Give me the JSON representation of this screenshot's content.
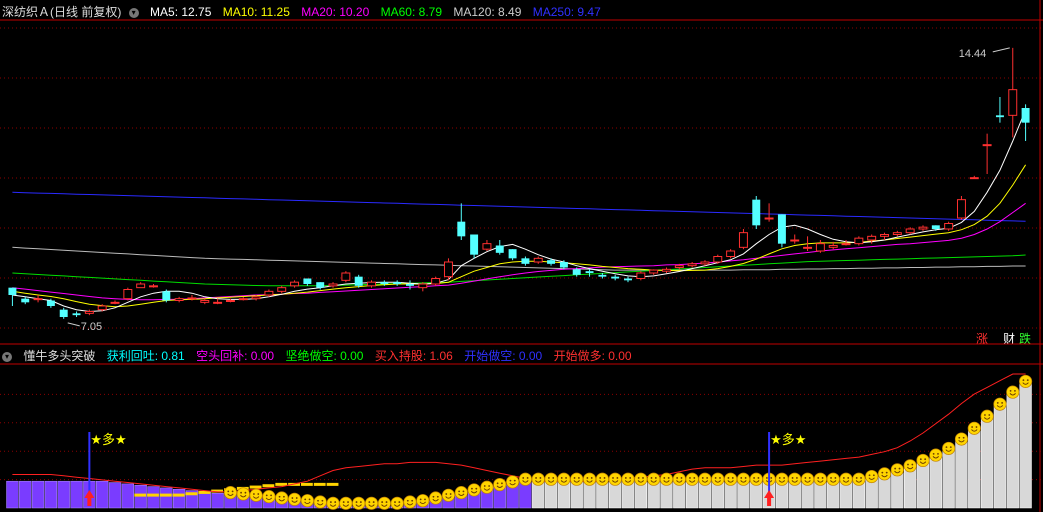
{
  "main_panel": {
    "stock_title": "深纺织Ａ(日线 前复权)",
    "ma": [
      {
        "label": "MA5: 12.75",
        "color": "#ffffff"
      },
      {
        "label": "MA10: 11.25",
        "color": "#ffff00"
      },
      {
        "label": "MA20: 10.20",
        "color": "#ff00ff"
      },
      {
        "label": "MA60: 8.79",
        "color": "#00ff00"
      },
      {
        "label": "MA120: 8.49",
        "color": "#cccccc"
      },
      {
        "label": "MA250: 9.47",
        "color": "#3030ff"
      }
    ],
    "high_label": "14.44",
    "low_label": "7.05",
    "side_buttons": [
      {
        "label": "涨",
        "color": "#ff3030"
      },
      {
        "label": "财",
        "color": "#ffffff"
      },
      {
        "label": "跌",
        "color": "#30ff30"
      }
    ]
  },
  "indicator_panel": {
    "name": "懂牛多头突破",
    "values": [
      {
        "label": "获利回吐: 0.81",
        "color": "#00ffff"
      },
      {
        "label": "空头回补: 0.00",
        "color": "#ff00ff"
      },
      {
        "label": "坚绝做空: 0.00",
        "color": "#00ff00"
      },
      {
        "label": "买入持股: 1.06",
        "color": "#ff3030"
      },
      {
        "label": "开始做空: 0.00",
        "color": "#3030ff"
      },
      {
        "label": "开始做多: 0.00",
        "color": "#ff3030"
      }
    ],
    "signal_text": "★多★"
  },
  "colors": {
    "up": "#ff3030",
    "down": "#54ffff",
    "grid": "#8b0000",
    "separator": "#c00000"
  },
  "chart_data": {
    "type": "candlestick",
    "candles": [
      [
        7.9,
        7.9,
        7.4,
        7.7
      ],
      [
        7.6,
        7.65,
        7.45,
        7.5
      ],
      [
        7.6,
        7.7,
        7.5,
        7.6
      ],
      [
        7.55,
        7.6,
        7.35,
        7.4
      ],
      [
        7.3,
        7.35,
        7.05,
        7.1
      ],
      [
        7.2,
        7.25,
        7.1,
        7.15
      ],
      [
        7.2,
        7.3,
        7.15,
        7.25
      ],
      [
        7.3,
        7.45,
        7.25,
        7.4
      ],
      [
        7.5,
        7.55,
        7.45,
        7.5
      ],
      [
        7.6,
        7.9,
        7.55,
        7.85
      ],
      [
        7.9,
        8.05,
        7.9,
        8.0
      ],
      [
        7.95,
        8.0,
        7.9,
        7.95
      ],
      [
        7.8,
        7.85,
        7.5,
        7.55
      ],
      [
        7.55,
        7.65,
        7.5,
        7.6
      ],
      [
        7.6,
        7.7,
        7.55,
        7.62
      ],
      [
        7.5,
        7.6,
        7.45,
        7.55
      ],
      [
        7.5,
        7.6,
        7.45,
        7.5
      ],
      [
        7.55,
        7.6,
        7.5,
        7.55
      ],
      [
        7.6,
        7.65,
        7.55,
        7.6
      ],
      [
        7.6,
        7.7,
        7.55,
        7.65
      ],
      [
        7.7,
        7.85,
        7.65,
        7.8
      ],
      [
        7.8,
        7.95,
        7.75,
        7.9
      ],
      [
        7.95,
        8.1,
        7.9,
        8.05
      ],
      [
        8.15,
        8.15,
        7.95,
        8.0
      ],
      [
        8.05,
        8.05,
        7.85,
        7.9
      ],
      [
        7.95,
        8.05,
        7.9,
        8.0
      ],
      [
        8.1,
        8.35,
        8.05,
        8.3
      ],
      [
        8.2,
        8.25,
        7.9,
        7.95
      ],
      [
        7.95,
        8.1,
        7.9,
        8.05
      ],
      [
        8.05,
        8.1,
        7.95,
        8.0
      ],
      [
        8.05,
        8.1,
        7.95,
        8.0
      ],
      [
        8.0,
        8.1,
        7.85,
        7.95
      ],
      [
        7.9,
        8.05,
        7.8,
        8.0
      ],
      [
        8.0,
        8.2,
        7.95,
        8.15
      ],
      [
        8.2,
        8.7,
        8.1,
        8.6
      ],
      [
        9.7,
        10.2,
        9.2,
        9.3
      ],
      [
        9.35,
        9.35,
        8.7,
        8.8
      ],
      [
        8.95,
        9.2,
        8.9,
        9.1
      ],
      [
        9.05,
        9.2,
        8.8,
        8.85
      ],
      [
        8.95,
        8.95,
        8.65,
        8.7
      ],
      [
        8.7,
        8.75,
        8.5,
        8.55
      ],
      [
        8.6,
        8.75,
        8.55,
        8.7
      ],
      [
        8.65,
        8.7,
        8.5,
        8.55
      ],
      [
        8.6,
        8.65,
        8.4,
        8.45
      ],
      [
        8.4,
        8.45,
        8.2,
        8.25
      ],
      [
        8.35,
        8.4,
        8.2,
        8.3
      ],
      [
        8.25,
        8.3,
        8.15,
        8.2
      ],
      [
        8.2,
        8.25,
        8.1,
        8.15
      ],
      [
        8.15,
        8.2,
        8.05,
        8.1
      ],
      [
        8.15,
        8.35,
        8.1,
        8.3
      ],
      [
        8.3,
        8.4,
        8.25,
        8.38
      ],
      [
        8.35,
        8.45,
        8.3,
        8.4
      ],
      [
        8.45,
        8.55,
        8.4,
        8.5
      ],
      [
        8.5,
        8.6,
        8.45,
        8.55
      ],
      [
        8.55,
        8.65,
        8.5,
        8.6
      ],
      [
        8.6,
        8.8,
        8.55,
        8.75
      ],
      [
        8.75,
        8.95,
        8.7,
        8.9
      ],
      [
        9.0,
        9.5,
        8.95,
        9.4
      ],
      [
        10.3,
        10.4,
        9.5,
        9.6
      ],
      [
        9.8,
        10.2,
        9.7,
        9.8
      ],
      [
        9.9,
        9.9,
        9.0,
        9.1
      ],
      [
        9.2,
        9.35,
        9.1,
        9.2
      ],
      [
        9.0,
        9.3,
        8.9,
        9.0
      ],
      [
        8.9,
        9.2,
        8.85,
        9.1
      ],
      [
        9.0,
        9.15,
        8.95,
        9.05
      ],
      [
        9.1,
        9.2,
        9.05,
        9.1
      ],
      [
        9.1,
        9.3,
        9.05,
        9.25
      ],
      [
        9.2,
        9.35,
        9.1,
        9.3
      ],
      [
        9.3,
        9.4,
        9.2,
        9.35
      ],
      [
        9.35,
        9.45,
        9.3,
        9.4
      ],
      [
        9.4,
        9.55,
        9.35,
        9.5
      ],
      [
        9.5,
        9.6,
        9.45,
        9.55
      ],
      [
        9.6,
        9.6,
        9.45,
        9.5
      ],
      [
        9.5,
        9.7,
        9.45,
        9.65
      ],
      [
        9.8,
        10.4,
        9.75,
        10.3
      ],
      [
        10.9,
        10.95,
        10.9,
        10.9
      ],
      [
        11.8,
        12.1,
        11.0,
        11.8
      ],
      [
        12.6,
        13.1,
        12.4,
        12.55
      ],
      [
        12.6,
        14.44,
        12.0,
        13.3
      ],
      [
        12.8,
        12.9,
        11.9,
        12.4
      ]
    ],
    "ma5": [
      7.7,
      7.65,
      7.6,
      7.55,
      7.4,
      7.3,
      7.25,
      7.27,
      7.35,
      7.5,
      7.65,
      7.75,
      7.8,
      7.8,
      7.75,
      7.65,
      7.6,
      7.58,
      7.58,
      7.6,
      7.65,
      7.72,
      7.8,
      7.86,
      7.9,
      7.95,
      8.0,
      8.02,
      8.04,
      8.05,
      8.05,
      8.02,
      8.0,
      8.02,
      8.12,
      8.5,
      8.7,
      8.88,
      9.02,
      9.08,
      8.95,
      8.8,
      8.68,
      8.6,
      8.5,
      8.42,
      8.35,
      8.28,
      8.22,
      8.2,
      8.22,
      8.28,
      8.34,
      8.42,
      8.5,
      8.58,
      8.66,
      8.82,
      9.1,
      9.35,
      9.55,
      9.6,
      9.5,
      9.35,
      9.22,
      9.15,
      9.12,
      9.15,
      9.2,
      9.28,
      9.35,
      9.42,
      9.48,
      9.52,
      9.68,
      9.98,
      10.5,
      11.1,
      11.9,
      12.75
    ],
    "ma10": [
      7.8,
      7.75,
      7.7,
      7.66,
      7.6,
      7.52,
      7.45,
      7.41,
      7.38,
      7.4,
      7.45,
      7.5,
      7.55,
      7.57,
      7.58,
      7.6,
      7.62,
      7.64,
      7.66,
      7.68,
      7.7,
      7.72,
      7.75,
      7.78,
      7.82,
      7.86,
      7.9,
      7.93,
      7.96,
      7.98,
      8.0,
      8.0,
      8.0,
      8.01,
      8.05,
      8.2,
      8.35,
      8.45,
      8.55,
      8.6,
      8.62,
      8.62,
      8.6,
      8.58,
      8.55,
      8.52,
      8.48,
      8.45,
      8.42,
      8.4,
      8.38,
      8.37,
      8.36,
      8.37,
      8.38,
      8.42,
      8.48,
      8.56,
      8.68,
      8.82,
      8.96,
      9.05,
      9.1,
      9.12,
      9.12,
      9.12,
      9.14,
      9.17,
      9.2,
      9.24,
      9.28,
      9.32,
      9.36,
      9.4,
      9.48,
      9.62,
      9.85,
      10.2,
      10.7,
      11.25
    ],
    "ma20": [
      7.9,
      7.86,
      7.82,
      7.78,
      7.74,
      7.7,
      7.66,
      7.62,
      7.6,
      7.58,
      7.57,
      7.57,
      7.58,
      7.58,
      7.6,
      7.62,
      7.64,
      7.66,
      7.68,
      7.7,
      7.71,
      7.72,
      7.74,
      7.75,
      7.77,
      7.79,
      7.81,
      7.83,
      7.85,
      7.87,
      7.89,
      7.91,
      7.93,
      7.95,
      7.97,
      8.02,
      8.08,
      8.14,
      8.2,
      8.25,
      8.3,
      8.34,
      8.37,
      8.4,
      8.42,
      8.44,
      8.46,
      8.47,
      8.48,
      8.49,
      8.5,
      8.52,
      8.53,
      8.55,
      8.57,
      8.6,
      8.63,
      8.66,
      8.7,
      8.74,
      8.78,
      8.82,
      8.86,
      8.9,
      8.93,
      8.96,
      8.99,
      9.02,
      9.05,
      9.08,
      9.1,
      9.13,
      9.16,
      9.19,
      9.25,
      9.35,
      9.5,
      9.7,
      9.95,
      10.2
    ],
    "ma60": [
      8.3,
      8.28,
      8.26,
      8.24,
      8.22,
      8.2,
      8.18,
      8.16,
      8.14,
      8.12,
      8.1,
      8.08,
      8.06,
      8.04,
      8.02,
      8.0,
      7.99,
      7.98,
      7.97,
      7.96,
      7.95,
      7.95,
      7.95,
      7.95,
      7.95,
      7.96,
      7.97,
      7.98,
      7.99,
      8.0,
      8.01,
      8.02,
      8.03,
      8.04,
      8.05,
      8.07,
      8.09,
      8.11,
      8.13,
      8.15,
      8.17,
      8.19,
      8.21,
      8.23,
      8.25,
      8.27,
      8.29,
      8.31,
      8.33,
      8.35,
      8.37,
      8.39,
      8.41,
      8.43,
      8.45,
      8.47,
      8.49,
      8.51,
      8.53,
      8.55,
      8.57,
      8.59,
      8.61,
      8.62,
      8.63,
      8.64,
      8.65,
      8.66,
      8.67,
      8.68,
      8.69,
      8.7,
      8.71,
      8.72,
      8.73,
      8.74,
      8.75,
      8.76,
      8.77,
      8.79
    ],
    "ma120": [
      9.0,
      8.98,
      8.96,
      8.94,
      8.92,
      8.9,
      8.88,
      8.86,
      8.84,
      8.82,
      8.8,
      8.78,
      8.76,
      8.74,
      8.72,
      8.7,
      8.69,
      8.68,
      8.67,
      8.66,
      8.65,
      8.64,
      8.63,
      8.62,
      8.61,
      8.6,
      8.59,
      8.58,
      8.57,
      8.56,
      8.55,
      8.54,
      8.53,
      8.52,
      8.51,
      8.5,
      8.49,
      8.48,
      8.47,
      8.46,
      8.45,
      8.44,
      8.43,
      8.42,
      8.41,
      8.4,
      8.39,
      8.38,
      8.38,
      8.38,
      8.38,
      8.38,
      8.38,
      8.38,
      8.38,
      8.38,
      8.38,
      8.39,
      8.39,
      8.39,
      8.4,
      8.4,
      8.41,
      8.41,
      8.42,
      8.42,
      8.43,
      8.43,
      8.44,
      8.44,
      8.45,
      8.45,
      8.46,
      8.46,
      8.47,
      8.47,
      8.48,
      8.48,
      8.49,
      8.49
    ],
    "ma250": [
      10.5,
      10.49,
      10.48,
      10.47,
      10.46,
      10.45,
      10.44,
      10.43,
      10.42,
      10.41,
      10.4,
      10.39,
      10.38,
      10.37,
      10.36,
      10.35,
      10.34,
      10.33,
      10.32,
      10.31,
      10.3,
      10.29,
      10.28,
      10.27,
      10.26,
      10.25,
      10.24,
      10.23,
      10.22,
      10.21,
      10.2,
      10.19,
      10.18,
      10.17,
      10.16,
      10.15,
      10.14,
      10.13,
      10.12,
      10.11,
      10.1,
      10.09,
      10.08,
      10.07,
      10.06,
      10.05,
      10.04,
      10.03,
      10.02,
      10.01,
      10.0,
      9.99,
      9.98,
      9.97,
      9.96,
      9.95,
      9.94,
      9.93,
      9.92,
      9.91,
      9.9,
      9.89,
      9.88,
      9.87,
      9.86,
      9.85,
      9.84,
      9.83,
      9.82,
      9.81,
      9.8,
      9.79,
      9.78,
      9.77,
      9.76,
      9.75,
      9.74,
      9.73,
      9.72,
      9.71
    ],
    "ylim": [
      6.8,
      15.2
    ],
    "indicator": {
      "bars": [
        0.2,
        0.2,
        0.2,
        0.2,
        0.2,
        0.2,
        0.2,
        0.2,
        0.19,
        0.18,
        0.17,
        0.16,
        0.15,
        0.14,
        0.13,
        0.12,
        0.11,
        0.1,
        0.09,
        0.08,
        0.07,
        0.06,
        0.05,
        0.04,
        0.03,
        0.02,
        0.02,
        0.02,
        0.02,
        0.02,
        0.02,
        0.03,
        0.04,
        0.06,
        0.08,
        0.1,
        0.12,
        0.14,
        0.16,
        0.18,
        0.2,
        0.2,
        0.2,
        0.2,
        0.2,
        0.2,
        0.2,
        0.2,
        0.2,
        0.2,
        0.2,
        0.2,
        0.2,
        0.2,
        0.2,
        0.2,
        0.2,
        0.2,
        0.2,
        0.2,
        0.2,
        0.2,
        0.2,
        0.2,
        0.2,
        0.2,
        0.2,
        0.22,
        0.24,
        0.27,
        0.3,
        0.34,
        0.38,
        0.43,
        0.5,
        0.58,
        0.67,
        0.76,
        0.85,
        0.93
      ],
      "bar_type": [
        "violet",
        "violet",
        "violet",
        "violet",
        "violet",
        "violet",
        "violet",
        "violet",
        "violet",
        "violet",
        "violet",
        "violet",
        "violet",
        "violet",
        "violet",
        "violet",
        "violet",
        "violet",
        "violet",
        "violet",
        "violet",
        "violet",
        "violet",
        "violet",
        "violet",
        "violet",
        "violet",
        "violet",
        "violet",
        "violet",
        "violet",
        "violet",
        "violet",
        "violet",
        "violet",
        "violet",
        "violet",
        "violet",
        "violet",
        "violet",
        "violet",
        "white",
        "white",
        "white",
        "white",
        "white",
        "white",
        "white",
        "white",
        "white",
        "white",
        "white",
        "white",
        "white",
        "white",
        "white",
        "white",
        "white",
        "white",
        "white",
        "white",
        "white",
        "white",
        "white",
        "white",
        "white",
        "white",
        "white",
        "white",
        "white",
        "white",
        "white",
        "white",
        "white",
        "white",
        "white",
        "white",
        "white",
        "white",
        "white"
      ],
      "smiley_from": 17,
      "red_line": [
        0.25,
        0.25,
        0.25,
        0.25,
        0.24,
        0.23,
        0.22,
        0.21,
        0.2,
        0.19,
        0.18,
        0.17,
        0.16,
        0.15,
        0.14,
        0.13,
        0.12,
        0.12,
        0.13,
        0.14,
        0.15,
        0.16,
        0.18,
        0.2,
        0.24,
        0.28,
        0.3,
        0.31,
        0.32,
        0.33,
        0.33,
        0.34,
        0.34,
        0.34,
        0.33,
        0.32,
        0.3,
        0.28,
        0.26,
        0.24,
        0.22,
        0.2,
        0.2,
        0.2,
        0.2,
        0.2,
        0.2,
        0.21,
        0.22,
        0.23,
        0.24,
        0.25,
        0.27,
        0.29,
        0.3,
        0.3,
        0.3,
        0.31,
        0.32,
        0.32,
        0.32,
        0.33,
        0.34,
        0.35,
        0.36,
        0.37,
        0.38,
        0.4,
        0.42,
        0.45,
        0.5,
        0.56,
        0.63,
        0.7,
        0.78,
        0.85,
        0.9,
        0.95,
        1.0,
        1.0
      ],
      "yellow_dashes": [
        0.1,
        0.1,
        0.1,
        0.1,
        0.11,
        0.12,
        0.13,
        0.14,
        0.15,
        0.16,
        0.17,
        0.18,
        0.18,
        0.18,
        0.18,
        0.18
      ]
    },
    "signals": [
      6,
      59
    ]
  }
}
